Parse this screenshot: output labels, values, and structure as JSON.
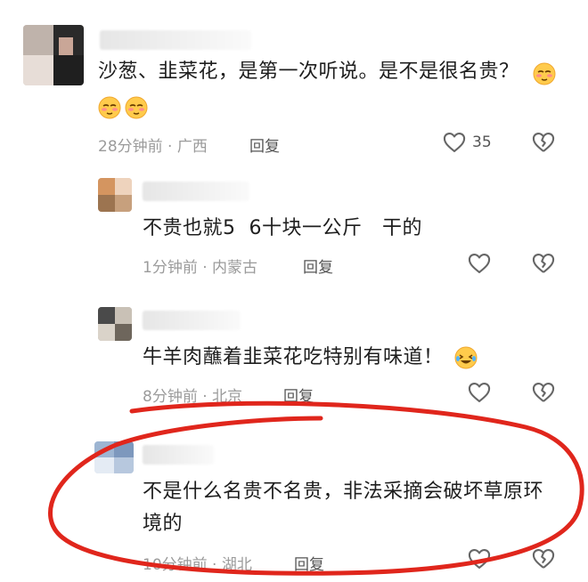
{
  "comments": [
    {
      "text": "沙葱、韭菜花，是第一次听说。是不是很名贵？",
      "meta": "28分钟前 · 广西",
      "reply_label": "回复",
      "like_count": "35",
      "avatar_colors": [
        "#2b2b2b",
        "#c4a899",
        "#e9d9d1"
      ]
    },
    {
      "text": "不贵也就5  6十块一公斤   干的",
      "meta": "1分钟前 · 内蒙古",
      "reply_label": "回复",
      "avatar_colors": [
        "#d9a06b",
        "#e6c3a5",
        "#8c6a4a"
      ]
    },
    {
      "text": "牛羊肉蘸着韭菜花吃特别有味道！",
      "meta": "8分钟前 · 北京",
      "reply_label": "回复",
      "avatar_colors": [
        "#5a5a5a",
        "#a8a095",
        "#d7cfc4"
      ]
    },
    {
      "text_line1": "不是什么名贵不名贵，非法采摘会破坏草原环",
      "text_line2": "境的",
      "meta": "10分钟前 · 湖北",
      "reply_label": "回复",
      "avatar_colors": [
        "#8fa8c8",
        "#c9d6e6",
        "#e8eef6"
      ]
    }
  ],
  "annotation": {
    "stroke_color": "#e0261c"
  },
  "icons": {
    "like": "heart-outline-icon",
    "dislike": "broken-heart-icon",
    "emoji_smile": "blushing-face-emoji",
    "emoji_laugh": "laughing-tears-emoji"
  }
}
